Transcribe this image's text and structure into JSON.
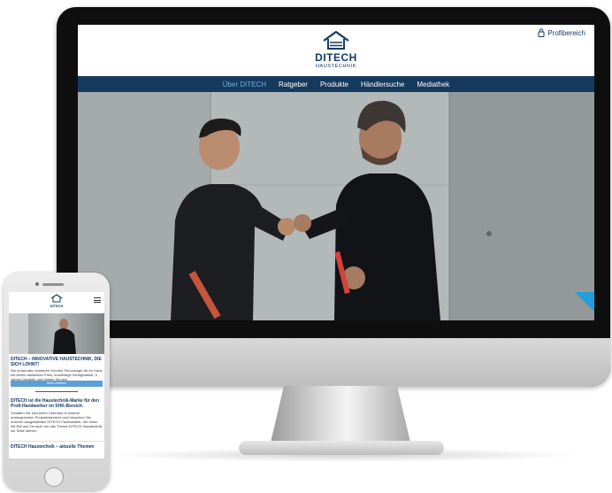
{
  "site": {
    "logo": {
      "name": "DITECH",
      "sub": "HAUSTECHNIK"
    },
    "profi_link": "Profibereich",
    "nav": [
      {
        "label": "Über DITECH",
        "active": true
      },
      {
        "label": "Ratgeber",
        "active": false
      },
      {
        "label": "Produkte",
        "active": false
      },
      {
        "label": "Händlersuche",
        "active": false
      },
      {
        "label": "Mediathek",
        "active": false
      }
    ]
  },
  "mobile": {
    "logo_name": "DITECH",
    "heading1": "DITECH – INNOVATIVE HAUSTECHNIK, DIE SICH LOHNT!",
    "body1": "Wir fordernden sonderen Kunden Technologie für Ihr Haus mit einem attraktiven Preis, kurzfristige Verfügbarkeit, 5 Jahres Garantie und besten Service.",
    "button": "Mehr erfahren",
    "heading2": "DITECH ist die Haustechnik-Marke für den Profi-Handwerker im SHK-Bereich.",
    "body2": "Schaffen Sie sich einen Überblick in unserer umfangreichen Produktübersicht und besuchen Sie unseren ausgewählten DITECH Fachhändler, der Ihnen mit Rat und Tat auch um das Thema DITECH Haustechnik zur Seite stehen.",
    "heading3": "DITECH Haustechnik – aktuelle Themen"
  },
  "colors": {
    "brand_navy": "#163a5e",
    "nav_active": "#6fb1e0",
    "accent_blue": "#1fa0d8"
  }
}
